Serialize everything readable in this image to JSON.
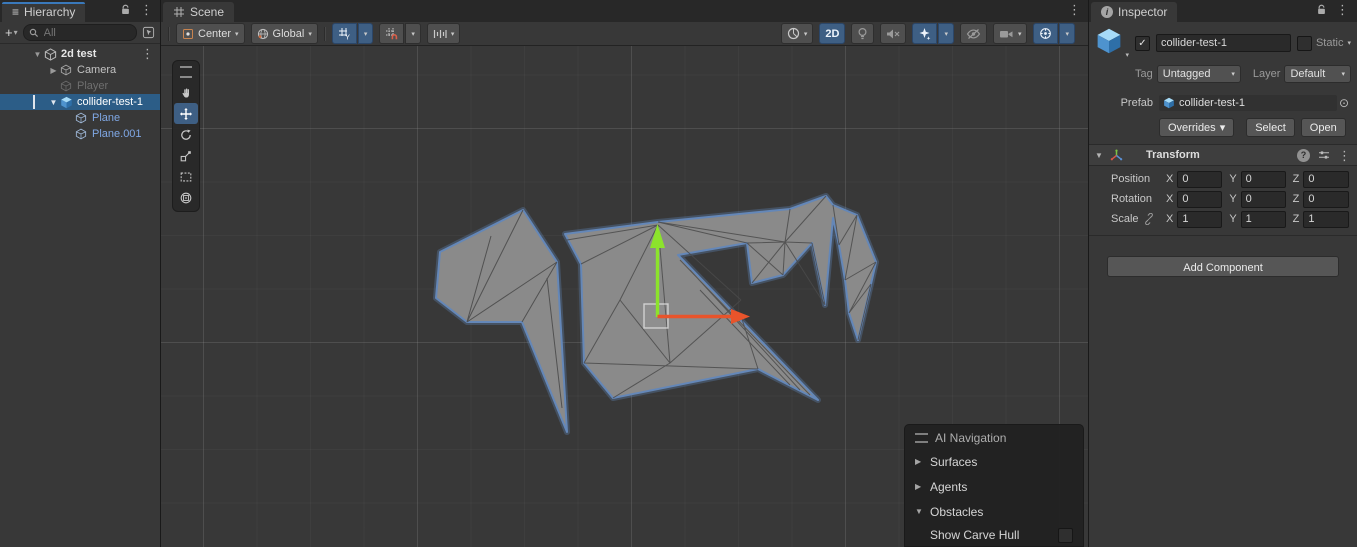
{
  "icons": {
    "kebab": "⋮",
    "dropdown": "▾",
    "plus": "+",
    "foldout_open": "▼",
    "foldout_closed": "▶",
    "check": "✓",
    "pick_target": "⊙",
    "hamburger": "≡",
    "hash": "#",
    "info": "i",
    "help": "?"
  },
  "hierarchy": {
    "tab_label": "Hierarchy",
    "search_placeholder": "All",
    "scene_row": {
      "label": "2d test"
    },
    "items": [
      {
        "label": "Camera"
      },
      {
        "label": "Player"
      },
      {
        "label": "collider-test-1"
      },
      {
        "label": "Plane"
      },
      {
        "label": "Plane.001"
      }
    ]
  },
  "scene": {
    "tab_label": "Scene",
    "toolbar": {
      "pivot_label": "Center",
      "orientation_label": "Global",
      "mode_2d_label": "2D"
    },
    "overlay": {
      "title": "AI Navigation",
      "rows": [
        {
          "label": "Surfaces"
        },
        {
          "label": "Agents"
        },
        {
          "label": "Obstacles"
        }
      ],
      "carve_label": "Show Carve Hull"
    }
  },
  "inspector": {
    "tab_label": "Inspector",
    "header": {
      "name_value": "collider-test-1",
      "static_label": "Static",
      "tag_label": "Tag",
      "tag_value": "Untagged",
      "layer_label": "Layer",
      "layer_value": "Default",
      "prefab_label": "Prefab",
      "prefab_value": "collider-test-1",
      "overrides_label": "Overrides",
      "select_label": "Select",
      "open_label": "Open"
    },
    "transform": {
      "title": "Transform",
      "axis_x": "X",
      "axis_y": "Y",
      "axis_z": "Z",
      "rows": [
        {
          "label": "Position",
          "x": "0",
          "y": "0",
          "z": "0"
        },
        {
          "label": "Rotation",
          "x": "0",
          "y": "0",
          "z": "0"
        },
        {
          "label": "Scale",
          "x": "1",
          "y": "1",
          "z": "1"
        }
      ]
    },
    "add_component_label": "Add Component"
  },
  "colors": {
    "selection_blue": "#2C5D87",
    "toolbar_active_blue": "#3E5F84",
    "prefab_text_blue": "#7FA7E4",
    "mesh_fill": "#8A8A8A",
    "mesh_outline_blue": "#6487B8",
    "gizmo_green": "#8CE32C",
    "gizmo_red": "#E8542B"
  }
}
